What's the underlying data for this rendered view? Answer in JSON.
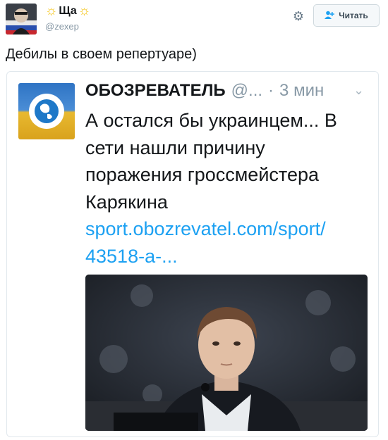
{
  "tweet": {
    "author": {
      "name": "Ща",
      "handle": "@zexep"
    },
    "follow_label": "Читать",
    "text": "Дебилы в своем репертуаре)"
  },
  "quoted": {
    "author": {
      "name": "ОБОЗРЕВАТЕЛЬ",
      "handle": "@...",
      "separator": "·",
      "time": "3 мин"
    },
    "text_lines": [
      "А остался бы украинцем... В",
      "сети нашли причину",
      "поражения гроссмейстера",
      "Карякина"
    ],
    "link_lines": [
      "sport.obozrevatel.com/sport/",
      "43518-a-..."
    ]
  },
  "icons": {
    "sun": "sun-icon",
    "gear": "gear-icon",
    "follow": "add-person-icon",
    "chevron": "chevron-down-icon"
  },
  "colors": {
    "accent": "#1da1f2",
    "muted": "#8899a6"
  }
}
